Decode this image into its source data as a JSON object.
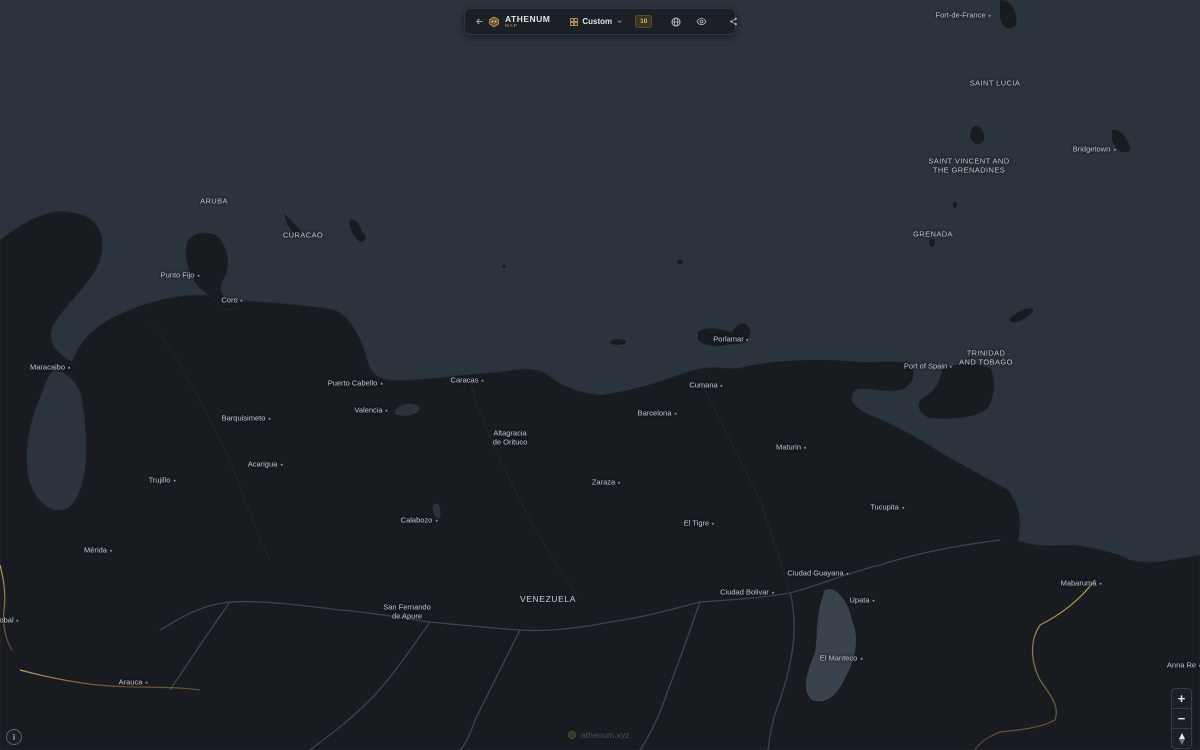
{
  "toolbar": {
    "brand_name": "ATHENUM",
    "brand_sub": "MAP",
    "style_label": "Custom",
    "count_badge": "10",
    "icons": [
      "back-arrow-icon",
      "athenum-logo-icon",
      "grid-icon",
      "chevron-down-icon",
      "globe-icon",
      "eye-icon",
      "share-icon"
    ]
  },
  "map": {
    "countries": [
      {
        "name": "VENEZUELA"
      },
      {
        "name": "ARUBA"
      },
      {
        "name": "CURACAO"
      },
      {
        "name": "GRENADA"
      },
      {
        "name": "SAINT LUCIA"
      },
      {
        "name": "SAINT VINCENT AND THE GRENADINES",
        "lines": [
          "SAINT VINCENT AND",
          "THE GRENADINES"
        ]
      },
      {
        "name": "TRINIDAD AND TOBAGO",
        "lines": [
          "TRINIDAD",
          "AND TOBAGO"
        ]
      }
    ],
    "cities": [
      {
        "name": "Fort-de-France"
      },
      {
        "name": "Bridgetown"
      },
      {
        "name": "Punto Fijo"
      },
      {
        "name": "Coro"
      },
      {
        "name": "Porlamar"
      },
      {
        "name": "Port of Spain"
      },
      {
        "name": "Maracaibo"
      },
      {
        "name": "Puerto Cabello"
      },
      {
        "name": "Caracas"
      },
      {
        "name": "Cumana"
      },
      {
        "name": "Barquisimeto"
      },
      {
        "name": "Valencia"
      },
      {
        "name": "Altagracia de Orituco",
        "lines": [
          "Altagracia",
          "de Orituco"
        ]
      },
      {
        "name": "Barcelona"
      },
      {
        "name": "Maturin"
      },
      {
        "name": "Acarigua"
      },
      {
        "name": "Trujillo"
      },
      {
        "name": "Zaraza"
      },
      {
        "name": "Tucupita"
      },
      {
        "name": "Calabozo"
      },
      {
        "name": "El Tigre"
      },
      {
        "name": "Mérida"
      },
      {
        "name": "Ciudad Guayana"
      },
      {
        "name": "Mabaruma"
      },
      {
        "name": "Ciudad Bolivar"
      },
      {
        "name": "Upata"
      },
      {
        "name": "San Fernando de Apure",
        "lines": [
          "San Fernando",
          "de Apure"
        ]
      },
      {
        "name": "tobal"
      },
      {
        "name": "El Manteco"
      },
      {
        "name": "Anna Re"
      },
      {
        "name": "Arauca"
      }
    ],
    "colors": {
      "sea": "#2b333d",
      "land": "#181c21",
      "border": "#c8a060",
      "river": "#3a4450"
    }
  },
  "zoom": {
    "in_label": "+",
    "out_label": "−"
  },
  "watermark": {
    "text": "athenum.xyz"
  }
}
